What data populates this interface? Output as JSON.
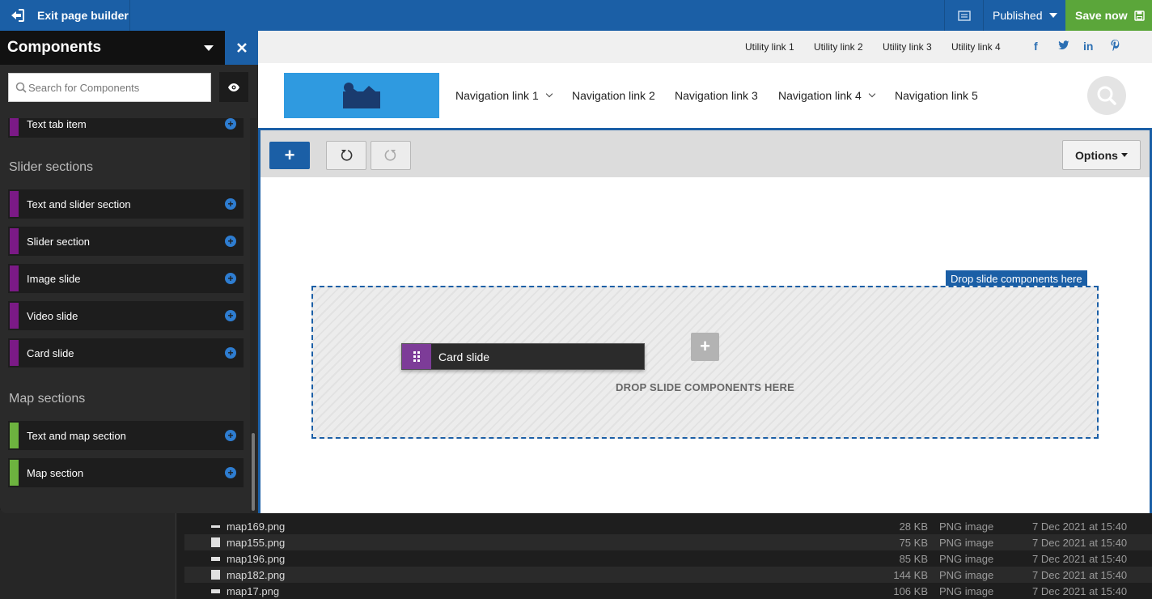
{
  "topbar": {
    "exit_label": "Exit page builder",
    "status_label": "Published",
    "save_label": "Save now"
  },
  "sidebar": {
    "title": "Components",
    "search_placeholder": "Search for Components",
    "partial_item": {
      "label": "Text tab item",
      "color": "#7b1a86"
    },
    "sections": [
      {
        "title": "Slider sections",
        "items": [
          {
            "label": "Text and slider section",
            "color": "#7b1a86"
          },
          {
            "label": "Slider section",
            "color": "#7b1a86"
          },
          {
            "label": "Image slide",
            "color": "#7b1a86"
          },
          {
            "label": "Video slide",
            "color": "#7b1a86"
          },
          {
            "label": "Card slide",
            "color": "#7b1a86"
          }
        ]
      },
      {
        "title": "Map sections",
        "items": [
          {
            "label": "Text and map section",
            "color": "#6db33f"
          },
          {
            "label": "Map section",
            "color": "#6db33f"
          }
        ]
      }
    ]
  },
  "site": {
    "utility_links": [
      "Utility link 1",
      "Utility link 2",
      "Utility link 3",
      "Utility link 4"
    ],
    "social_icons": [
      "f",
      "t",
      "in",
      "p"
    ],
    "nav_links": [
      {
        "label": "Navigation link 1",
        "has_dropdown": true
      },
      {
        "label": "Navigation link 2",
        "has_dropdown": false
      },
      {
        "label": "Navigation link 3",
        "has_dropdown": false
      },
      {
        "label": "Navigation link 4",
        "has_dropdown": true
      },
      {
        "label": "Navigation link 5",
        "has_dropdown": false
      }
    ]
  },
  "editor": {
    "options_label": "Options",
    "drop_tag": "Drop slide components here",
    "drop_text": "DROP SLIDE COMPONENTS HERE",
    "dragging_label": "Card slide"
  },
  "files": [
    {
      "name": "map169.png",
      "size": "28 KB",
      "kind": "PNG image",
      "date": "7 Dec 2021 at 15:40"
    },
    {
      "name": "map155.png",
      "size": "75 KB",
      "kind": "PNG image",
      "date": "7 Dec 2021 at 15:40"
    },
    {
      "name": "map196.png",
      "size": "85 KB",
      "kind": "PNG image",
      "date": "7 Dec 2021 at 15:40"
    },
    {
      "name": "map182.png",
      "size": "144 KB",
      "kind": "PNG image",
      "date": "7 Dec 2021 at 15:40"
    },
    {
      "name": "map17.png",
      "size": "106 KB",
      "kind": "PNG image",
      "date": "7 Dec 2021 at 15:40"
    }
  ],
  "colors": {
    "primary": "#1b5fa6",
    "save": "#5ba63a",
    "slider_accent": "#7b1a86",
    "map_accent": "#6db33f"
  }
}
